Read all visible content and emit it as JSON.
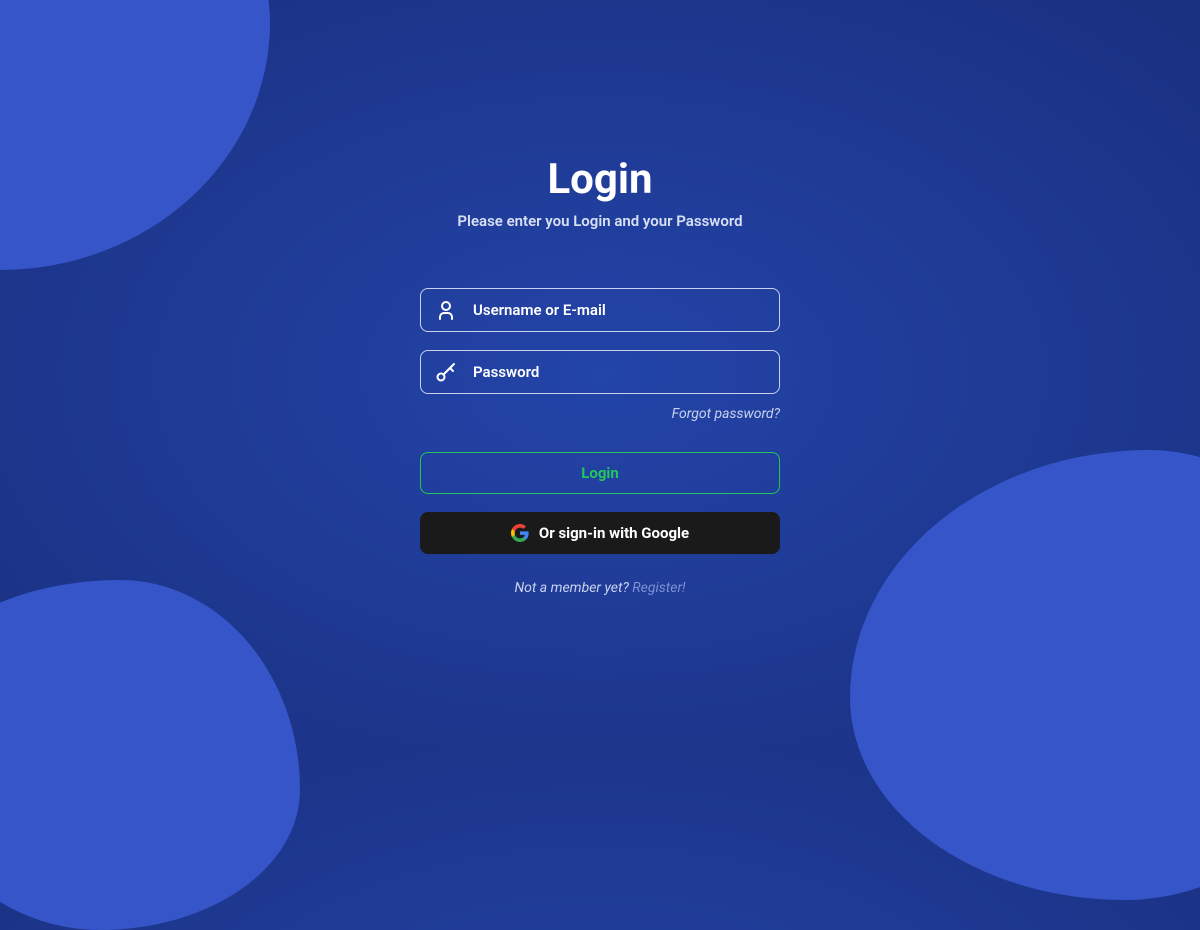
{
  "colors": {
    "background_center": "#2344a8",
    "background_edge": "#1a3080",
    "blob": "#3555c8",
    "accent_green": "#22c55e",
    "text_muted": "#c9d3f0"
  },
  "login": {
    "title": "Login",
    "subtitle": "Please enter you Login and your Password",
    "username_placeholder": "Username or E-mail",
    "password_placeholder": "Password",
    "forgot_label": "Forgot password?",
    "login_button_label": "Login",
    "google_button_label": "Or sign-in with Google",
    "register_prompt": "Not a member yet? ",
    "register_link_label": "Register!"
  },
  "icons": {
    "user": "user-icon",
    "key": "key-icon",
    "google": "google-icon"
  }
}
